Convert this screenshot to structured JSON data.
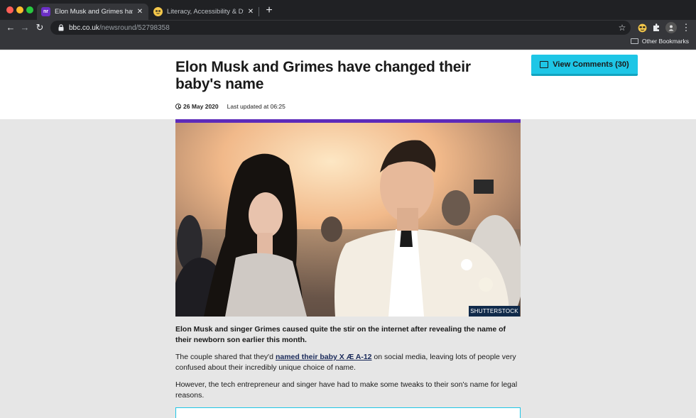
{
  "browser": {
    "tabs": [
      {
        "title": "Elon Musk and Grimes have ch",
        "favicon": "nr",
        "active": true
      },
      {
        "title": "Literacy, Accessibility & Dyslex",
        "favicon": "sunglasses-emoji",
        "active": false
      }
    ],
    "close_glyph": "✕",
    "new_tab_glyph": "+",
    "back_glyph": "←",
    "forward_glyph": "→",
    "reload_glyph": "↻",
    "url_host": "bbc.co.uk",
    "url_path": "/newsround/52798358",
    "star_glyph": "☆",
    "menu_glyph": "⋮",
    "other_bookmarks": "Other Bookmarks"
  },
  "article": {
    "headline": "Elon Musk and Grimes have changed their baby's name",
    "comments_button": "View Comments (30)",
    "date": "26 May 2020",
    "last_updated": "Last updated at 06:25",
    "image_credit": "SHUTTERSTOCK",
    "intro": "Elon Musk and singer Grimes caused quite the stir on the internet after revealing the name of their newborn son earlier this month.",
    "para2_before": "The couple shared that they'd ",
    "para2_link": "named their baby X Æ A-12",
    "para2_after": " on social media, leaving lots of people very confused about their incredibly unique choice of name.",
    "para3": "However, the tech entrepreneur and singer have had to make some tweaks to their son's name for legal reasons."
  },
  "colors": {
    "accent_cyan": "#1ec6e6",
    "purple_rule": "#5d2bba",
    "credit_bg": "#102a4a",
    "chrome_dark": "#202124"
  }
}
